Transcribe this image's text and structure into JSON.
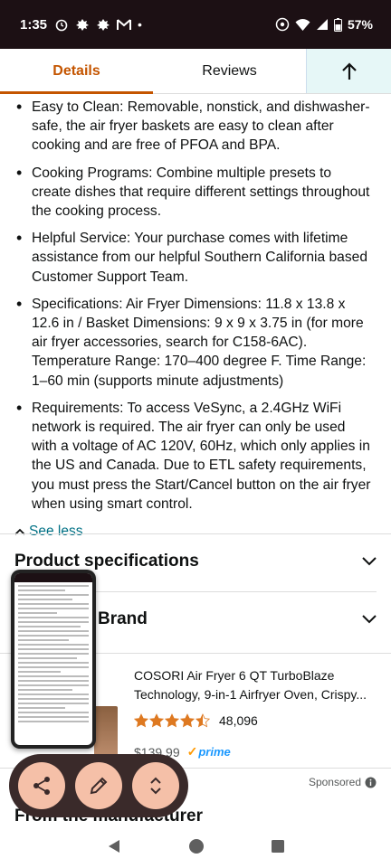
{
  "status": {
    "time": "1:35",
    "battery": "57%"
  },
  "tabs": {
    "details": "Details",
    "reviews": "Reviews"
  },
  "bullets": [
    "Easy to Clean: Removable, nonstick, and dishwasher-safe, the air fryer baskets are easy to clean after cooking and are free of PFOA and BPA.",
    "Cooking Programs: Combine multiple presets to create dishes that require different settings throughout the cooking process.",
    "Helpful Service: Your purchase comes with lifetime assistance from our helpful Southern California based Customer Support Team.",
    "Specifications: Air Fryer Dimensions: 11.8 x 13.8 x 12.6 in / Basket Dimensions: 9 x 9 x 3.75 in (for more air fryer accessories, search for C158-6AC). Temperature Range: 170–400 degree F. Time Range: 1–60 min (supports minute adjustments)",
    "Requirements: To access VeSync, a 2.4GHz WiFi network is required. The air fryer can only be used with a voltage of AC 120V, 60Hz, which only applies in the US and Canada. Due to ETL safety requirements, you must press the Start/Cancel button on the air fryer when using smart control."
  ],
  "see_less": "See less",
  "sections": {
    "product_specs": "Product specifications",
    "brand": "Brand",
    "from_manufacturer": "From the manufacturer"
  },
  "product": {
    "title": "COSORI Air Fryer 6 QT TurboBlaze Technology, 9-in-1 Airfryer Oven, Crispy...",
    "rating": 4.5,
    "review_count": "48,096",
    "price": "$139.99",
    "prime": "prime"
  },
  "sponsored": "Sponsored",
  "colors": {
    "accent": "#c45500",
    "link": "#007185",
    "star": "#de7921",
    "float_btn": "#f5c0a8"
  },
  "icons": [
    "alarm-icon",
    "notification-icon",
    "gmail-icon",
    "hotspot-icon",
    "wifi-icon",
    "signal-icon",
    "battery-icon",
    "arrow-up-icon",
    "chevron-up-icon",
    "chevron-down-icon",
    "share-icon",
    "edit-icon",
    "expand-icon",
    "info-icon",
    "back-icon",
    "home-icon",
    "recents-icon"
  ]
}
